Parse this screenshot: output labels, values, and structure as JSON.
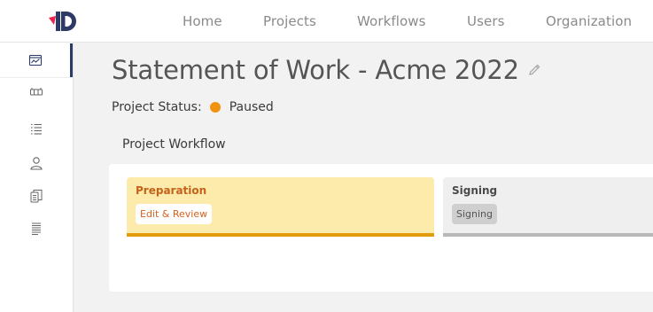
{
  "nav": {
    "logo_icon": "d-logo-icon",
    "items": [
      {
        "label": "Home"
      },
      {
        "label": "Projects"
      },
      {
        "label": "Workflows"
      },
      {
        "label": "Users"
      },
      {
        "label": "Organization"
      }
    ]
  },
  "sidebar": {
    "items": [
      {
        "icon": "dashboard-chart-icon",
        "active": true
      },
      {
        "icon": "kanban-icon",
        "active": false
      },
      {
        "icon": "list-icon",
        "active": false
      },
      {
        "icon": "user-icon",
        "active": false
      },
      {
        "icon": "documents-icon",
        "active": false
      },
      {
        "icon": "text-lines-icon",
        "active": false
      }
    ]
  },
  "page": {
    "title": "Statement of Work - Acme 2022",
    "edit_icon": "pencil-icon",
    "status_label": "Project Status:",
    "status_value": "Paused",
    "status_color": "#f2930f",
    "workflow_heading": "Project Workflow"
  },
  "workflow": {
    "stages": [
      {
        "title": "Preparation",
        "chip": "Edit & Review",
        "accent": "#e29c0a",
        "background": "#fcebaa"
      },
      {
        "title": "Signing",
        "chip": "Signing",
        "accent": "#b8b8b8",
        "background": "#efefef"
      }
    ]
  }
}
